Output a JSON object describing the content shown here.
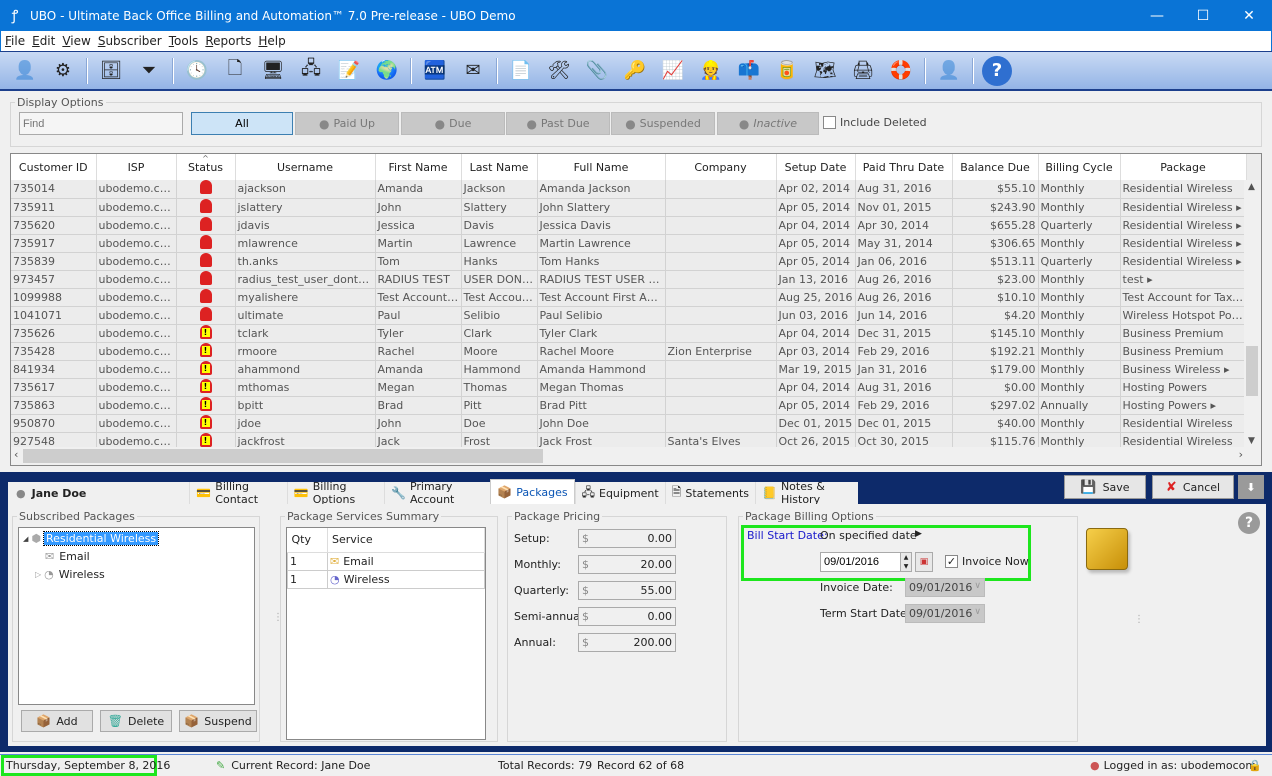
{
  "window": {
    "title": "UBO - Ultimate Back Office Billing and Automation™ 7.0 Pre-release - UBO Demo",
    "controls": [
      "minimize",
      "maximize",
      "close"
    ]
  },
  "menu": [
    "File",
    "Edit",
    "View",
    "Subscriber",
    "Tools",
    "Reports",
    "Help"
  ],
  "toolbar": {
    "icons": [
      {
        "name": "add-user-icon",
        "glyph": "👤",
        "disabled": true
      },
      {
        "name": "settings-gears-icon",
        "glyph": "⚙"
      },
      {
        "sep": true
      },
      {
        "name": "import-export-icon",
        "glyph": "🗄"
      },
      {
        "name": "filter-icon",
        "glyph": "⏷"
      },
      {
        "sep": true
      },
      {
        "name": "clock-icon",
        "glyph": "🕓"
      },
      {
        "name": "document-icon",
        "glyph": "🗋"
      },
      {
        "name": "user-computer-icon",
        "glyph": "🖥"
      },
      {
        "name": "network-icon",
        "glyph": "🖧"
      },
      {
        "name": "edit-notes-icon",
        "glyph": "📝"
      },
      {
        "name": "globe-pin-icon",
        "glyph": "🌍"
      },
      {
        "sep": true
      },
      {
        "name": "payment-terminal-icon",
        "glyph": "🏧"
      },
      {
        "name": "email-money-icon",
        "glyph": "✉"
      },
      {
        "sep": true
      },
      {
        "name": "add-note-icon",
        "glyph": "📄"
      },
      {
        "name": "add-tool-note-icon",
        "glyph": "🛠"
      },
      {
        "name": "add-attachment-icon",
        "glyph": "📎"
      },
      {
        "name": "checklist-key-icon",
        "glyph": "🔑"
      },
      {
        "name": "chart-icon",
        "glyph": "📈"
      },
      {
        "name": "technician-icon",
        "glyph": "👷"
      },
      {
        "name": "mailbox-icon",
        "glyph": "📫"
      },
      {
        "name": "spam-icon",
        "glyph": "🥫"
      },
      {
        "name": "map-icon",
        "glyph": "🗺"
      },
      {
        "name": "numbered-list-printer-icon",
        "glyph": "🖨"
      },
      {
        "name": "lifebuoy-icon",
        "glyph": "🛟"
      },
      {
        "sep": true
      },
      {
        "name": "remove-user-icon",
        "glyph": "👤",
        "disabled": true
      },
      {
        "sep": true
      },
      {
        "name": "help-icon",
        "glyph": "?"
      }
    ]
  },
  "display_options": {
    "legend": "Display Options",
    "find_placeholder": "Find",
    "filters": [
      {
        "label": "All",
        "active": true
      },
      {
        "label": "Paid Up"
      },
      {
        "label": "Due"
      },
      {
        "label": "Past Due"
      },
      {
        "label": "Suspended"
      },
      {
        "label": "Inactive"
      }
    ],
    "include_deleted_label": "Include Deleted",
    "include_deleted": false
  },
  "grid": {
    "columns": [
      "Customer ID",
      "ISP",
      "Status",
      "Username",
      "First Name",
      "Last Name",
      "Full Name",
      "Company",
      "Setup Date",
      "Paid Thru Date",
      "Balance Due",
      "Billing Cycle",
      "Package"
    ],
    "sorted_column": "Status",
    "rows": [
      {
        "id": "735014",
        "isp": "ubodemo.com",
        "status": "past-due",
        "username": "ajackson",
        "first": "Amanda",
        "last": "Jackson",
        "full": "Amanda Jackson",
        "company": "",
        "setup": "Apr 02, 2014",
        "paid": "Aug 31, 2016",
        "balance": "$55.10",
        "cycle": "Monthly",
        "package": "Residential Wireless"
      },
      {
        "id": "735911",
        "isp": "ubodemo.com",
        "status": "past-due",
        "username": "jslattery",
        "first": "John",
        "last": "Slattery",
        "full": "John Slattery",
        "company": "",
        "setup": "Apr 05, 2014",
        "paid": "Nov 01, 2015",
        "balance": "$243.90",
        "cycle": "Monthly",
        "package": "Residential Wireless ▸"
      },
      {
        "id": "735620",
        "isp": "ubodemo.com",
        "status": "past-due",
        "username": "jdavis",
        "first": "Jessica",
        "last": "Davis",
        "full": "Jessica Davis",
        "company": "",
        "setup": "Apr 04, 2014",
        "paid": "Apr 30, 2014",
        "balance": "$655.28",
        "cycle": "Quarterly",
        "package": "Residential Wireless ▸"
      },
      {
        "id": "735917",
        "isp": "ubodemo.com",
        "status": "past-due",
        "username": "mlawrence",
        "first": "Martin",
        "last": "Lawrence",
        "full": "Martin Lawrence",
        "company": "",
        "setup": "Apr 05, 2014",
        "paid": "May 31, 2014",
        "balance": "$306.65",
        "cycle": "Monthly",
        "package": "Residential Wireless ▸"
      },
      {
        "id": "735839",
        "isp": "ubodemo.com",
        "status": "past-due",
        "username": "th.anks",
        "first": "Tom",
        "last": "Hanks",
        "full": "Tom Hanks",
        "company": "",
        "setup": "Apr 05, 2014",
        "paid": "Jan 06, 2016",
        "balance": "$513.11",
        "cycle": "Quarterly",
        "package": "Residential Wireless ▸"
      },
      {
        "id": "973457",
        "isp": "ubodemo.com",
        "status": "past-due",
        "username": "radius_test_user_dont_d...",
        "first": "RADIUS TEST",
        "last": "USER DONT...",
        "full": "RADIUS TEST USER D...",
        "company": "",
        "setup": "Jan 13, 2016",
        "paid": "Aug 26, 2016",
        "balance": "$23.00",
        "cycle": "Monthly",
        "package": "test ▸"
      },
      {
        "id": "1099988",
        "isp": "ubodemo.com",
        "status": "past-due",
        "username": "myalishere",
        "first": "Test Account ...",
        "last": "Test Accoun...",
        "full": "Test Account First AL T...",
        "company": "",
        "setup": "Aug 25, 2016",
        "paid": "Aug 26, 2016",
        "balance": "$10.10",
        "cycle": "Monthly",
        "package": "Test Account for Taxes"
      },
      {
        "id": "1041071",
        "isp": "ubodemo.com",
        "status": "past-due",
        "username": "ultimate",
        "first": "Paul",
        "last": "Selibio",
        "full": "Paul Selibio",
        "company": "",
        "setup": "Jun 03, 2016",
        "paid": "Jun 14, 2016",
        "balance": "$4.20",
        "cycle": "Monthly",
        "package": "Wireless Hotspot Power"
      },
      {
        "id": "735626",
        "isp": "ubodemo.com",
        "status": "due",
        "username": "tclark",
        "first": "Tyler",
        "last": "Clark",
        "full": "Tyler Clark",
        "company": "",
        "setup": "Apr 04, 2014",
        "paid": "Dec 31, 2015",
        "balance": "$145.10",
        "cycle": "Monthly",
        "package": "Business Premium"
      },
      {
        "id": "735428",
        "isp": "ubodemo.com",
        "status": "due",
        "username": "rmoore",
        "first": "Rachel",
        "last": "Moore",
        "full": "Rachel Moore",
        "company": "Zion Enterprise",
        "setup": "Apr 03, 2014",
        "paid": "Feb 29, 2016",
        "balance": "$192.21",
        "cycle": "Monthly",
        "package": "Business Premium"
      },
      {
        "id": "841934",
        "isp": "ubodemo.com",
        "status": "due",
        "username": "ahammond",
        "first": "Amanda",
        "last": "Hammond",
        "full": "Amanda Hammond",
        "company": "",
        "setup": "Mar 19, 2015",
        "paid": "Jan 31, 2016",
        "balance": "$179.00",
        "cycle": "Monthly",
        "package": "Business Wireless ▸"
      },
      {
        "id": "735617",
        "isp": "ubodemo.com",
        "status": "due",
        "username": "mthomas",
        "first": "Megan",
        "last": "Thomas",
        "full": "Megan Thomas",
        "company": "",
        "setup": "Apr 04, 2014",
        "paid": "Aug 31, 2016",
        "balance": "$0.00",
        "cycle": "Monthly",
        "package": "Hosting Powers"
      },
      {
        "id": "735863",
        "isp": "ubodemo.com",
        "status": "due",
        "username": "bpitt",
        "first": "Brad",
        "last": "Pitt",
        "full": "Brad Pitt",
        "company": "",
        "setup": "Apr 05, 2014",
        "paid": "Feb 29, 2016",
        "balance": "$297.02",
        "cycle": "Annually",
        "package": "Hosting Powers ▸"
      },
      {
        "id": "950870",
        "isp": "ubodemo.com",
        "status": "due",
        "username": "jdoe",
        "first": "John",
        "last": "Doe",
        "full": "John Doe",
        "company": "",
        "setup": "Dec 01, 2015",
        "paid": "Dec 01, 2015",
        "balance": "$40.00",
        "cycle": "Monthly",
        "package": "Residential Wireless"
      },
      {
        "id": "927548",
        "isp": "ubodemo.com",
        "status": "due",
        "username": "jackfrost",
        "first": "Jack",
        "last": "Frost",
        "full": "Jack Frost",
        "company": "Santa's Elves",
        "setup": "Oct 26, 2015",
        "paid": "Oct 30, 2015",
        "balance": "$115.76",
        "cycle": "Monthly",
        "package": "Residential Wireless"
      }
    ]
  },
  "detail": {
    "customer_name": "Jane Doe",
    "tabs": [
      {
        "label": "Billing Contact",
        "icon": "billing-contact-icon",
        "glyph": "💳"
      },
      {
        "label": "Billing Options",
        "icon": "billing-options-icon",
        "glyph": "💳"
      },
      {
        "label": "Primary Account",
        "icon": "primary-account-icon",
        "glyph": "🔧"
      },
      {
        "label": "Packages",
        "icon": "packages-icon",
        "glyph": "📦",
        "active": true
      },
      {
        "label": "Equipment",
        "icon": "equipment-icon",
        "glyph": "🖧"
      },
      {
        "label": "Statements",
        "icon": "statements-icon",
        "glyph": "🗎"
      },
      {
        "label": "Notes & History",
        "icon": "notes-history-icon",
        "glyph": "📒"
      }
    ],
    "save_label": "Save",
    "cancel_label": "Cancel",
    "subscribed_packages": {
      "legend": "Subscribed Packages",
      "tree": [
        {
          "label": "Residential Wireless",
          "level": 0,
          "expanded": true,
          "selected": true
        },
        {
          "label": "Email",
          "level": 1
        },
        {
          "label": "Wireless",
          "level": 1,
          "expandable": true
        }
      ],
      "add_label": "Add",
      "delete_label": "Delete",
      "suspend_label": "Suspend"
    },
    "services_summary": {
      "legend": "Package Services Summary",
      "columns": [
        "Qty",
        "Service"
      ],
      "rows": [
        {
          "qty": "1",
          "service": "Email"
        },
        {
          "qty": "1",
          "service": "Wireless"
        }
      ]
    },
    "pricing": {
      "legend": "Package Pricing",
      "currency": "$",
      "rows": [
        {
          "label": "Setup:",
          "value": "0.00"
        },
        {
          "label": "Monthly:",
          "value": "20.00"
        },
        {
          "label": "Quarterly:",
          "value": "55.00"
        },
        {
          "label": "Semi-annual",
          "value": "0.00"
        },
        {
          "label": "Annual:",
          "value": "200.00"
        }
      ]
    },
    "billing_options": {
      "legend": "Package Billing Options",
      "bill_start_label": "Bill Start Date:",
      "bill_start_value": "On specified date",
      "bill_start_date": "09/01/2016",
      "invoice_now_label": "Invoice Now",
      "invoice_now": true,
      "invoice_date_label": "Invoice Date:",
      "invoice_date": "09/01/2016",
      "term_start_label": "Term Start Date:",
      "term_start_date": "09/01/2016"
    }
  },
  "status_bar": {
    "date": "Thursday, September 8, 2016",
    "current_record": "Current Record: Jane Doe",
    "total_records": "Total Records: 79",
    "record_position": "Record 62 of 68",
    "logged_in": "Logged in as: ubodemocom"
  },
  "colors": {
    "titlebar": "#0a74d6",
    "highlight": "#1de61d",
    "selection": "#3399ff",
    "link": "#1a1acc"
  }
}
